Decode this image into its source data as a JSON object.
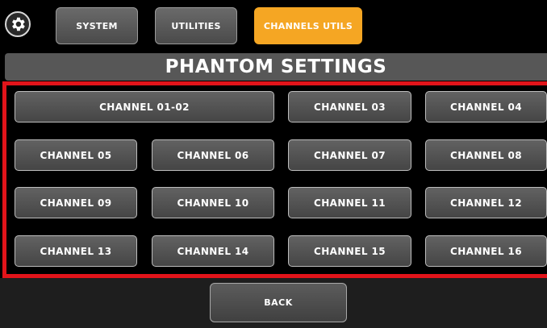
{
  "header": {
    "settings_icon": "gear-icon",
    "tabs": [
      {
        "label": "SYSTEM",
        "active": false
      },
      {
        "label": "UTILITIES",
        "active": false
      },
      {
        "label": "CHANNELS UTILS",
        "active": true
      }
    ]
  },
  "title": "PHANTOM SETTINGS",
  "channels": [
    "CHANNEL 01-02",
    "CHANNEL 03",
    "CHANNEL 04",
    "CHANNEL 05",
    "CHANNEL 06",
    "CHANNEL 07",
    "CHANNEL 08",
    "CHANNEL 09",
    "CHANNEL 10",
    "CHANNEL 11",
    "CHANNEL 12",
    "CHANNEL 13",
    "CHANNEL 14",
    "CHANNEL 15",
    "CHANNEL 16"
  ],
  "footer": {
    "back_label": "BACK"
  },
  "colors": {
    "accent": "#f5a623",
    "highlight_border": "#e1141a",
    "title_bar": "#575757",
    "background": "#000000"
  }
}
